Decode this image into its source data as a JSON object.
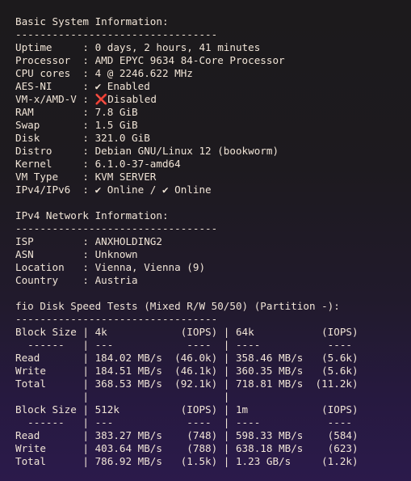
{
  "terminal": {
    "lines": [
      "Basic System Information:",
      "---------------------------------",
      "Uptime     : 0 days, 2 hours, 41 minutes",
      "Processor  : AMD EPYC 9634 84-Core Processor",
      "CPU cores  : 4 @ 2246.622 MHz",
      "AES-NI     : ✔ Enabled",
      "VM-x/AMD-V : ❌Disabled",
      "RAM        : 7.8 GiB",
      "Swap       : 1.5 GiB",
      "Disk       : 321.0 GiB",
      "Distro     : Debian GNU/Linux 12 (bookworm)",
      "Kernel     : 6.1.0-37-amd64",
      "VM Type    : KVM SERVER",
      "IPv4/IPv6  : ✔ Online / ✔ Online",
      "",
      "IPv4 Network Information:",
      "---------------------------------",
      "ISP        : ANXHOLDING2",
      "ASN        : Unknown",
      "Location   : Vienna, Vienna (9)",
      "Country    : Austria",
      "",
      "fio Disk Speed Tests (Mixed R/W 50/50) (Partition -):",
      "---------------------------------",
      "Block Size | 4k            (IOPS) | 64k           (IOPS)",
      "  ------   | ---            ----  | ----           ----",
      "Read       | 184.02 MB/s  (46.0k) | 358.46 MB/s   (5.6k)",
      "Write      | 184.51 MB/s  (46.1k) | 360.35 MB/s   (5.6k)",
      "Total      | 368.53 MB/s  (92.1k) | 718.81 MB/s  (11.2k)",
      "           |                      |",
      "Block Size | 512k          (IOPS) | 1m            (IOPS)",
      "  ------   | ---            ----  | ----           ----",
      "Read       | 383.27 MB/s    (748) | 598.33 MB/s    (584)",
      "Write      | 403.64 MB/s    (788) | 638.18 MB/s    (623)",
      "Total      | 786.92 MB/s   (1.5k) | 1.23 GB/s     (1.2k)"
    ]
  }
}
